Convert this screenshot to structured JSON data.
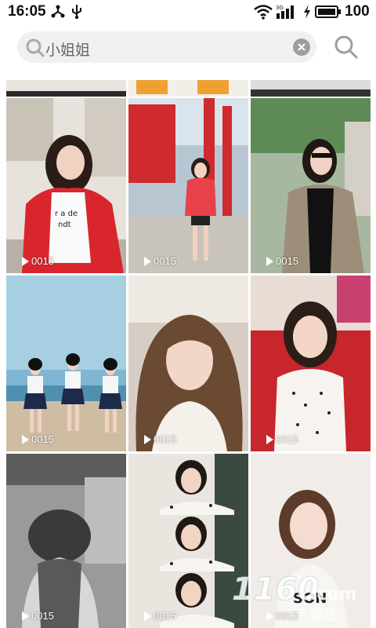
{
  "status_bar": {
    "time": "16:05",
    "battery": "100",
    "icons": [
      "usb-share-icon",
      "usb-icon",
      "wifi-icon",
      "signal-3g-icon",
      "charging-icon",
      "battery-icon"
    ]
  },
  "search": {
    "query": "小姐姐",
    "icon": "search-icon",
    "clear_icon": "clear-icon",
    "button_icon": "search-icon"
  },
  "videos": [
    {
      "count": "0015",
      "scene": "girl in red jacket"
    },
    {
      "count": "0015",
      "scene": "girl at red structure"
    },
    {
      "count": "0015",
      "scene": "girl in plaid coat with sunglasses"
    },
    {
      "count": "0015",
      "scene": "three girls on beach"
    },
    {
      "count": "0015",
      "scene": "girl with long wavy hair"
    },
    {
      "count": "0015",
      "scene": "girl on red sofa"
    },
    {
      "count": "0015",
      "scene": "black and white back view"
    },
    {
      "count": "0015",
      "scene": "girl in polka dot top"
    },
    {
      "count": "0015",
      "scene": "girl in white sweater"
    }
  ],
  "watermark": {
    "brand": "1160",
    "domain": ".com",
    "caption": "下载站"
  },
  "colors": {
    "accent_red": "#d8262c",
    "search_bg": "#f0f0f0",
    "icon_grey": "#9e9e9e"
  }
}
